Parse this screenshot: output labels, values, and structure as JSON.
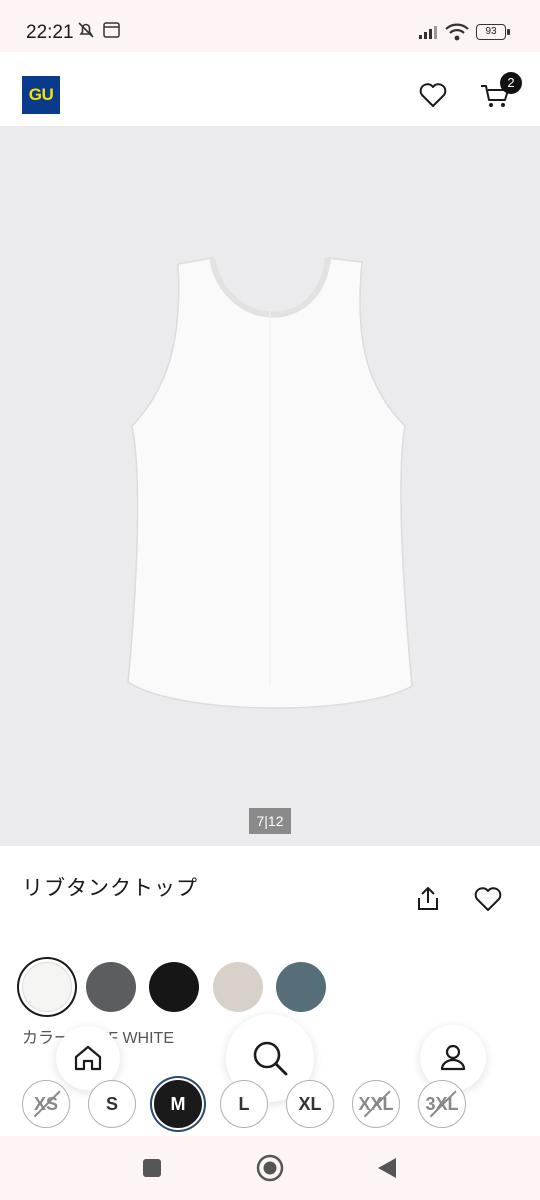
{
  "status_bar": {
    "time": "22:21",
    "battery": "93"
  },
  "header": {
    "logo_text": "GU",
    "cart_count": "2"
  },
  "product": {
    "image_indicator": "7|12",
    "title": "リブタンクトップ"
  },
  "colors": {
    "label": "カラー：OFF WHITE",
    "swatches": [
      {
        "name": "OFF WHITE",
        "hex": "#f5f5f3",
        "selected": true
      },
      {
        "name": "DARK GRAY",
        "hex": "#5c5d60"
      },
      {
        "name": "BLACK",
        "hex": "#161616"
      },
      {
        "name": "BEIGE",
        "hex": "#d7d1ca"
      },
      {
        "name": "BLUE GRAY",
        "hex": "#566e78"
      }
    ]
  },
  "sizes": [
    {
      "label": "XS",
      "available": false
    },
    {
      "label": "S",
      "available": true
    },
    {
      "label": "M",
      "available": true,
      "selected": true
    },
    {
      "label": "L",
      "available": true
    },
    {
      "label": "XL",
      "available": true
    },
    {
      "label": "XXL",
      "available": false
    },
    {
      "label": "3XL",
      "available": false
    }
  ],
  "icons": {
    "header": [
      "heart-icon",
      "cart-icon"
    ],
    "floating_nav": [
      "home-icon",
      "search-icon",
      "user-icon"
    ],
    "system_nav": [
      "recents-icon",
      "home-circle-icon",
      "back-icon"
    ]
  },
  "theme": {
    "brand_bg": "#0a3a8c",
    "brand_fg": "#f4e300",
    "image_bg": "#ebebed"
  }
}
